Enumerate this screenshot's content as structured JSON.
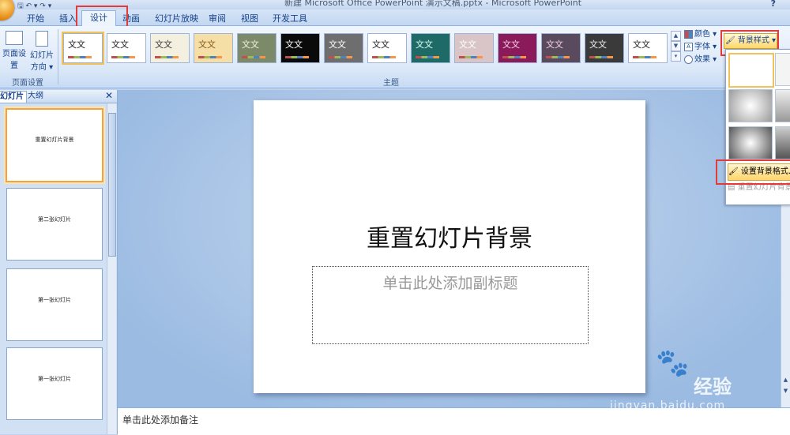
{
  "window": {
    "title": "新建 Microsoft Office PowerPoint 演示文稿.pptx - Microsoft PowerPoint",
    "help_icon": "?"
  },
  "qat": {
    "items": "🖫 ↶ ▾ ↷ ▾"
  },
  "tabs": [
    {
      "label": "开始"
    },
    {
      "label": "插入"
    },
    {
      "label": "设计",
      "active": true
    },
    {
      "label": "动画"
    },
    {
      "label": "幻灯片放映"
    },
    {
      "label": "审阅"
    },
    {
      "label": "视图"
    },
    {
      "label": "开发工具"
    }
  ],
  "ribbon": {
    "page_setup": {
      "group_label": "页面设置",
      "page_setup_btn": "页面设置",
      "orientation_btn_1": "幻灯片",
      "orientation_btn_2": "方向 ▾"
    },
    "themes": {
      "group_label": "主题",
      "items": [
        {
          "label": "文文",
          "bg": "#ffffff",
          "fg": "#222222"
        },
        {
          "label": "文文",
          "bg": "#ffffff",
          "fg": "#222222"
        },
        {
          "label": "文文",
          "bg": "#f4f0e0",
          "fg": "#3a3a3a"
        },
        {
          "label": "文文",
          "bg": "#f6dfa6",
          "fg": "#8a5a1a"
        },
        {
          "label": "文文",
          "bg": "#7c8a6a",
          "fg": "#f0f0e0"
        },
        {
          "label": "文文",
          "bg": "#0a0a0a",
          "fg": "#ffffff"
        },
        {
          "label": "文文",
          "bg": "#6e6e6e",
          "fg": "#ffffff"
        },
        {
          "label": "文文",
          "bg": "#ffffff",
          "fg": "#222222"
        },
        {
          "label": "文文",
          "bg": "#1d6a66",
          "fg": "#e0fff4"
        },
        {
          "label": "文文",
          "bg": "#d9c5c8",
          "fg": "#ffffff"
        },
        {
          "label": "文文",
          "bg": "#8a1a5a",
          "fg": "#f8d0ea"
        },
        {
          "label": "文文",
          "bg": "#5a4a5e",
          "fg": "#f0d0e0"
        },
        {
          "label": "文文",
          "bg": "#3a3a3a",
          "fg": "#f0f0f0"
        },
        {
          "label": "文文",
          "bg": "#ffffff",
          "fg": "#222222"
        }
      ]
    },
    "theme_options": {
      "colors": "颜色 ▾",
      "fonts": "字体 ▾",
      "effects": "效果 ▾"
    },
    "background": {
      "styles_btn": "背景样式 ▾",
      "format_background": "设置背景格式...",
      "reset_background": "重置幻灯片背景"
    }
  },
  "slides_pane": {
    "tab_slides": "幻灯片",
    "tab_outline": "大纲",
    "close": "✕",
    "thumbs": [
      {
        "label": "重置幻灯片背景"
      },
      {
        "label": "第二张幻灯片"
      },
      {
        "label": "第一张幻灯片"
      },
      {
        "label": "第一张幻灯片"
      }
    ]
  },
  "slide": {
    "title": "重置幻灯片背景",
    "subtitle_placeholder": "单击此处添加副标题"
  },
  "notes": {
    "placeholder": "单击此处添加备注"
  },
  "watermark": {
    "brand": "Bai",
    "cn": "经验",
    "url": "jingyan.baidu.com"
  },
  "colors": {
    "ribbon_text": "#15428b",
    "highlight_red": "#e33a3a",
    "selected_border": "#f3a33b"
  }
}
